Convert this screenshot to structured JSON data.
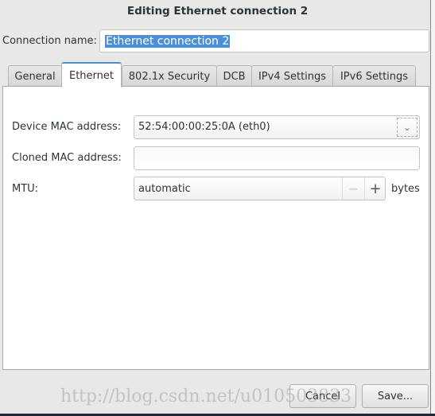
{
  "window": {
    "title": "Editing Ethernet connection 2"
  },
  "connection_name": {
    "label": "Connection name:",
    "value": "Ethernet connection 2"
  },
  "tabs": [
    {
      "label": "General"
    },
    {
      "label": "Ethernet",
      "active": true
    },
    {
      "label": "802.1x Security"
    },
    {
      "label": "DCB"
    },
    {
      "label": "IPv4 Settings"
    },
    {
      "label": "IPv6 Settings"
    }
  ],
  "ethernet": {
    "device_mac": {
      "label": "Device MAC address:",
      "value": "52:54:00:00:25:0A (eth0)"
    },
    "cloned_mac": {
      "label": "Cloned MAC address:",
      "value": ""
    },
    "mtu": {
      "label": "MTU:",
      "value": "automatic",
      "minus": "−",
      "plus": "+",
      "unit": "bytes"
    }
  },
  "buttons": {
    "cancel": "Cancel",
    "save": "Save..."
  },
  "watermark": "http://blog.csdn.net/u010503833",
  "colors": {
    "accent": "#4a90d9"
  }
}
